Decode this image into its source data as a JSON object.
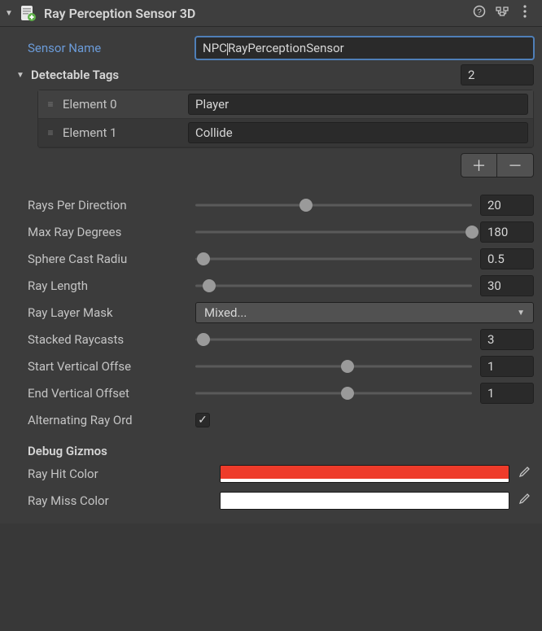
{
  "header": {
    "title": "Ray Perception Sensor 3D"
  },
  "sensorName": {
    "label": "Sensor Name",
    "value_pre": "NPC",
    "value_post": "RayPerceptionSensor"
  },
  "detectableTags": {
    "label": "Detectable Tags",
    "count": "2",
    "items": [
      {
        "label": "Element 0",
        "value": "Player"
      },
      {
        "label": "Element 1",
        "value": "Collide"
      }
    ]
  },
  "sliders": {
    "raysPerDirection": {
      "label": "Rays Per Direction",
      "value": "20",
      "percent": 40
    },
    "maxRayDegrees": {
      "label": "Max Ray Degrees",
      "value": "180",
      "percent": 100
    },
    "sphereCastRadius": {
      "label": "Sphere Cast Radius",
      "value": "0.5",
      "percent": 3
    },
    "rayLength": {
      "label": "Ray Length",
      "value": "30",
      "percent": 5
    },
    "stackedRaycasts": {
      "label": "Stacked Raycasts",
      "value": "3",
      "percent": 3
    },
    "startVertOffset": {
      "label": "Start Vertical Offset",
      "value": "1",
      "percent": 55
    },
    "endVertOffset": {
      "label": "End Vertical Offset",
      "value": "1",
      "percent": 55
    }
  },
  "rayLayerMask": {
    "label": "Ray Layer Mask",
    "value": "Mixed..."
  },
  "alternatingRayOrder": {
    "label": "Alternating Ray Order",
    "checked": true
  },
  "debugGizmos": {
    "title": "Debug Gizmos",
    "rayHitColor": {
      "label": "Ray Hit Color",
      "hex": "#ee3b2a"
    },
    "rayMissColor": {
      "label": "Ray Miss Color",
      "hex": "#ffffff"
    }
  }
}
